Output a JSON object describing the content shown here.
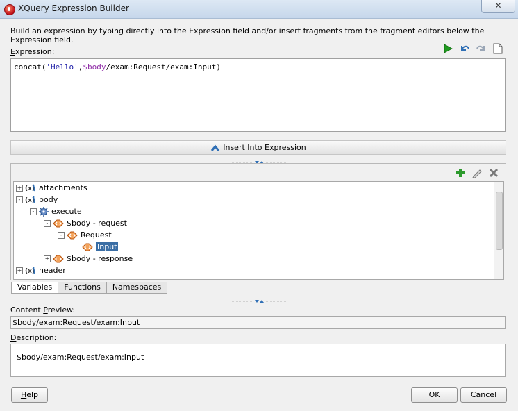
{
  "window": {
    "title": "XQuery Expression Builder",
    "close_glyph": "✕"
  },
  "intro_text": "Build an expression by typing directly into the Expression field and/or insert fragments from the fragment editors below the Expression field.",
  "expression": {
    "label": "Expression:",
    "tokens": [
      "concat(",
      "'Hello'",
      ",",
      "$body",
      "/exam:Request/exam:Input)"
    ]
  },
  "expression_toolbar": [
    "run-icon",
    "undo-icon",
    "redo-icon",
    "new-document-icon"
  ],
  "insert_button": {
    "label": "Insert Into Expression",
    "icon": "chevron-up-icon"
  },
  "tree_toolbar": [
    "add-icon",
    "edit-icon",
    "delete-icon"
  ],
  "tree": [
    {
      "label": "attachments",
      "expander": "+",
      "icon": "variable-icon"
    },
    {
      "label": "body",
      "expander": "-",
      "icon": "variable-icon"
    },
    {
      "label": "execute",
      "expander": "-",
      "icon": "operation-gear-icon"
    },
    {
      "label": "$body - request",
      "expander": "-",
      "icon": "element-icon"
    },
    {
      "label": "Request",
      "expander": "-",
      "icon": "element-icon"
    },
    {
      "label": "Input",
      "expander": "",
      "icon": "element-icon",
      "selected": true
    },
    {
      "label": "$body - response",
      "expander": "+",
      "icon": "element-icon"
    },
    {
      "label": "header",
      "expander": "+",
      "icon": "variable-icon"
    }
  ],
  "tabs": [
    {
      "label": "Variables",
      "active": true
    },
    {
      "label": "Functions",
      "active": false
    },
    {
      "label": "Namespaces",
      "active": false
    }
  ],
  "content_preview": {
    "label_before": "Content ",
    "label_mnemonic": "P",
    "label_after": "review:",
    "value": "$body/exam:Request/exam:Input"
  },
  "description": {
    "label_mnemonic": "D",
    "label_after": "escription:",
    "value": "$body/exam:Request/exam:Input"
  },
  "buttons": {
    "help_mnemonic": "H",
    "help_rest": "elp",
    "ok": "OK",
    "cancel": "Cancel"
  },
  "colors": {
    "run": "#1f9a1f",
    "selection": "#3a6ea5",
    "element_icon": "#e06a1a",
    "insert_chevron": "#2f6fb5"
  }
}
